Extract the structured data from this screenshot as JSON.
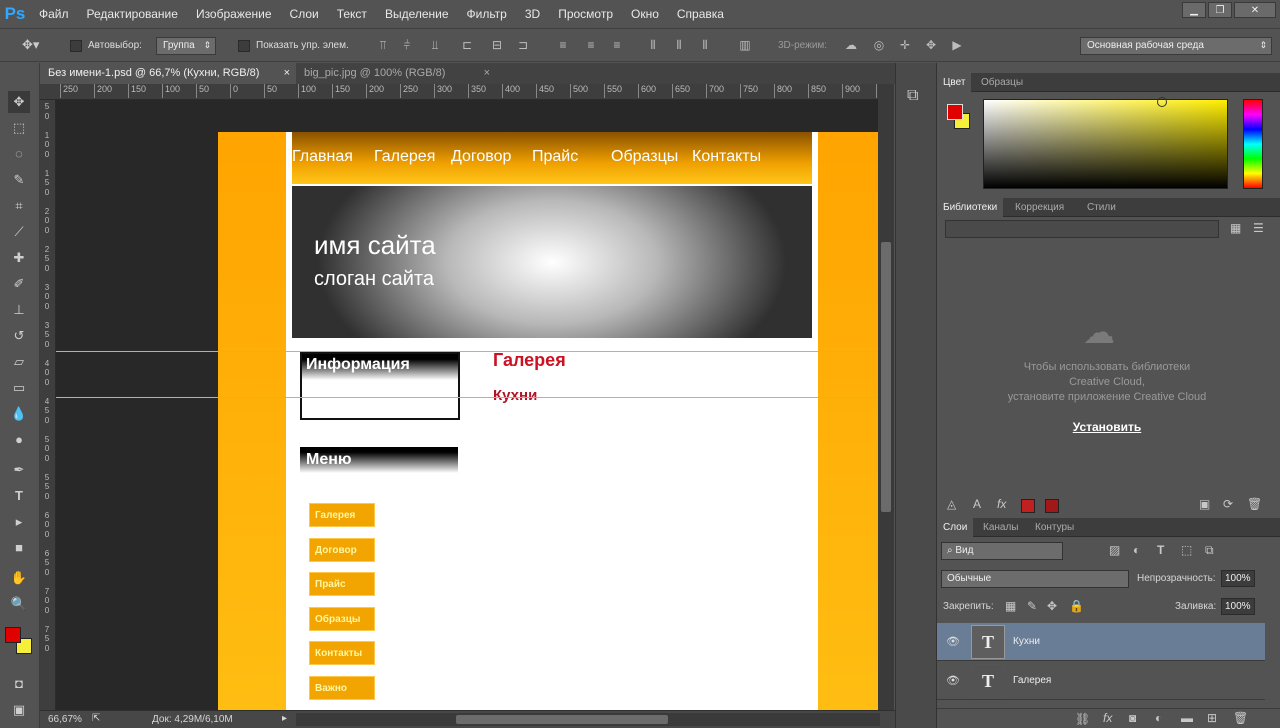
{
  "app": {
    "logo": "Ps"
  },
  "menu": [
    "Файл",
    "Редактирование",
    "Изображение",
    "Слои",
    "Текст",
    "Выделение",
    "Фильтр",
    "3D",
    "Просмотр",
    "Окно",
    "Справка"
  ],
  "options": {
    "autoselect_label": "Автовыбор:",
    "autoselect_value": "Группа",
    "show_controls_label": "Показать упр. элем.",
    "mode3d_label": "3D-режим:",
    "workspace": "Основная рабочая среда"
  },
  "tabs": [
    {
      "label": "Без имени-1.psd @ 66,7% (Кухни, RGB/8)",
      "close": "×"
    },
    {
      "label": "big_pic.jpg @ 100% (RGB/8)",
      "close": "×"
    }
  ],
  "rulers": {
    "h": [
      "250",
      "200",
      "150",
      "100",
      "50",
      "0",
      "50",
      "100",
      "150",
      "200",
      "250",
      "300",
      "350",
      "400",
      "450",
      "500",
      "550",
      "600",
      "650",
      "700",
      "750",
      "800",
      "850",
      "900",
      "950"
    ],
    "v": [
      "5",
      "0",
      "",
      "1",
      "0",
      "0",
      "",
      "1",
      "5",
      "0",
      "",
      "2",
      "0",
      "0",
      "",
      "2",
      "5",
      "0",
      "",
      "3",
      "0",
      "0",
      "",
      "3",
      "5",
      "0",
      "",
      "4",
      "0",
      "0",
      "",
      "4",
      "5",
      "0",
      "",
      "5",
      "0",
      "0",
      "",
      "5",
      "5",
      "0",
      "",
      "6",
      "0",
      "0",
      "",
      "6",
      "5",
      "0",
      "",
      "7",
      "0",
      "0",
      "",
      "7",
      "5",
      "0"
    ]
  },
  "site": {
    "nav": [
      "Главная",
      "Галерея",
      "Договор",
      "Прайс",
      "Образцы",
      "Контакты"
    ],
    "site_name": "имя сайта",
    "slogan": "слоган сайта",
    "info_title": "Информация",
    "menu_title": "Меню",
    "side_buttons": [
      "Галерея",
      "Договор",
      "Прайс",
      "Образцы",
      "Контакты",
      "Важно"
    ],
    "gallery_title": "Галерея",
    "gallery_sub": "Кухни"
  },
  "status": {
    "zoom": "66,67%",
    "doc": "Док: 4,29M/6,10M"
  },
  "color_panel": {
    "tabs": [
      "Цвет",
      "Образцы"
    ],
    "fg": "#e00000",
    "bg": "#f6ef3a"
  },
  "libraries": {
    "tabs": [
      "Библиотеки",
      "Коррекция",
      "Стили"
    ],
    "message": [
      "Чтобы использовать библиотеки",
      "Creative Cloud,",
      "установите приложение Creative Cloud"
    ],
    "install": "Установить"
  },
  "layers_panel": {
    "tabs": [
      "Слои",
      "Каналы",
      "Контуры"
    ],
    "filter": "Вид",
    "blend": "Обычные",
    "opacity_label": "Непрозрачность:",
    "opacity": "100%",
    "lock_label": "Закрепить:",
    "fill_label": "Заливка:",
    "fill": "100%",
    "layers": [
      {
        "name": "Кухни",
        "type": "T",
        "selected": true
      },
      {
        "name": "Галерея",
        "type": "T",
        "selected": false
      }
    ]
  }
}
